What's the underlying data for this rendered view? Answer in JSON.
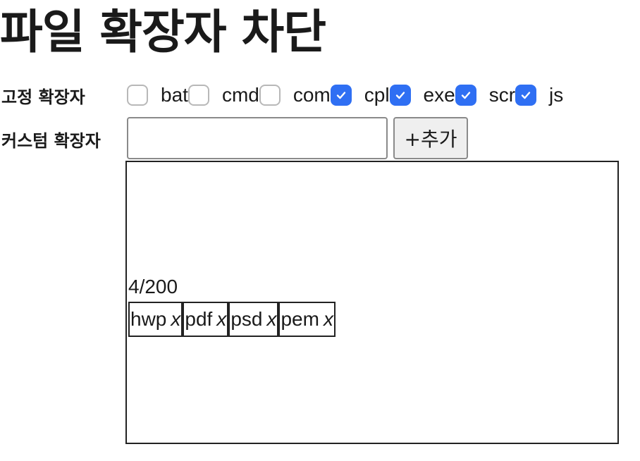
{
  "title": "파일 확장자 차단",
  "fixed": {
    "label": "고정 확장자",
    "extensions": [
      {
        "name": "bat",
        "checked": false
      },
      {
        "name": "cmd",
        "checked": false
      },
      {
        "name": "com",
        "checked": false
      },
      {
        "name": "cpl",
        "checked": true
      },
      {
        "name": "exe",
        "checked": true
      },
      {
        "name": "scr",
        "checked": true
      },
      {
        "name": "js",
        "checked": true
      }
    ]
  },
  "custom": {
    "label": "커스텀 확장자",
    "input_value": "",
    "add_label": "+추가",
    "counter": "4/200",
    "tags": [
      {
        "name": "hwp",
        "remove": "x"
      },
      {
        "name": "pdf",
        "remove": "x"
      },
      {
        "name": "psd",
        "remove": "x"
      },
      {
        "name": "pem",
        "remove": "x"
      }
    ]
  },
  "colors": {
    "checkbox_checked": "#2f6ff3"
  },
  "icons": {
    "check": "check-icon"
  }
}
